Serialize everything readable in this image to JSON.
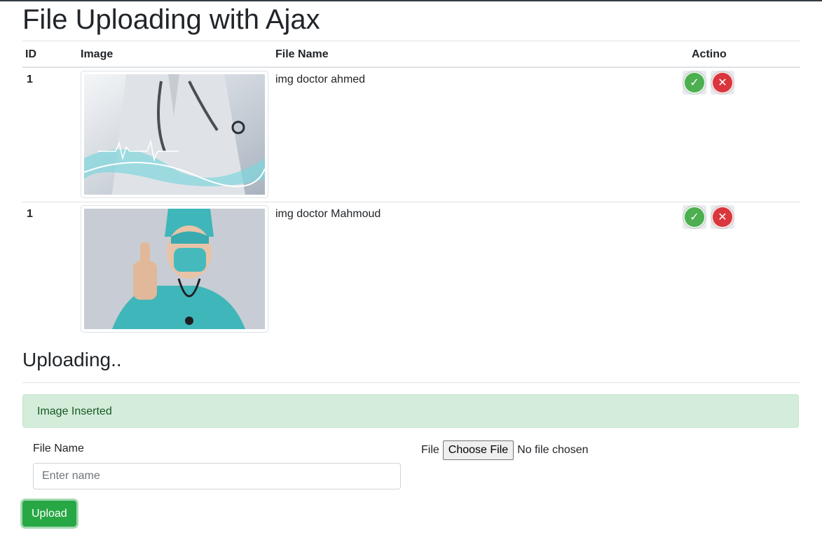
{
  "page": {
    "title": "File Uploading with Ajax"
  },
  "table": {
    "headers": {
      "id": "ID",
      "image": "Image",
      "file_name": "File Name",
      "action": "Actino"
    },
    "rows": [
      {
        "id": "1",
        "file_name": "img doctor ahmed"
      },
      {
        "id": "1",
        "file_name": "img doctor Mahmoud"
      }
    ]
  },
  "upload_section": {
    "heading": "Uploading..",
    "alert": "Image Inserted",
    "file_name_label": "File Name",
    "file_name_placeholder": "Enter name",
    "file_label": "File",
    "choose_file_label": "Choose File",
    "no_file_text": "No file chosen",
    "upload_button": "Upload"
  },
  "icons": {
    "approve": "check-circle-icon",
    "delete": "x-circle-icon"
  },
  "colors": {
    "success": "#28a745",
    "alert_bg": "#d4edda",
    "alert_text": "#155724",
    "delete": "#d9363e"
  }
}
